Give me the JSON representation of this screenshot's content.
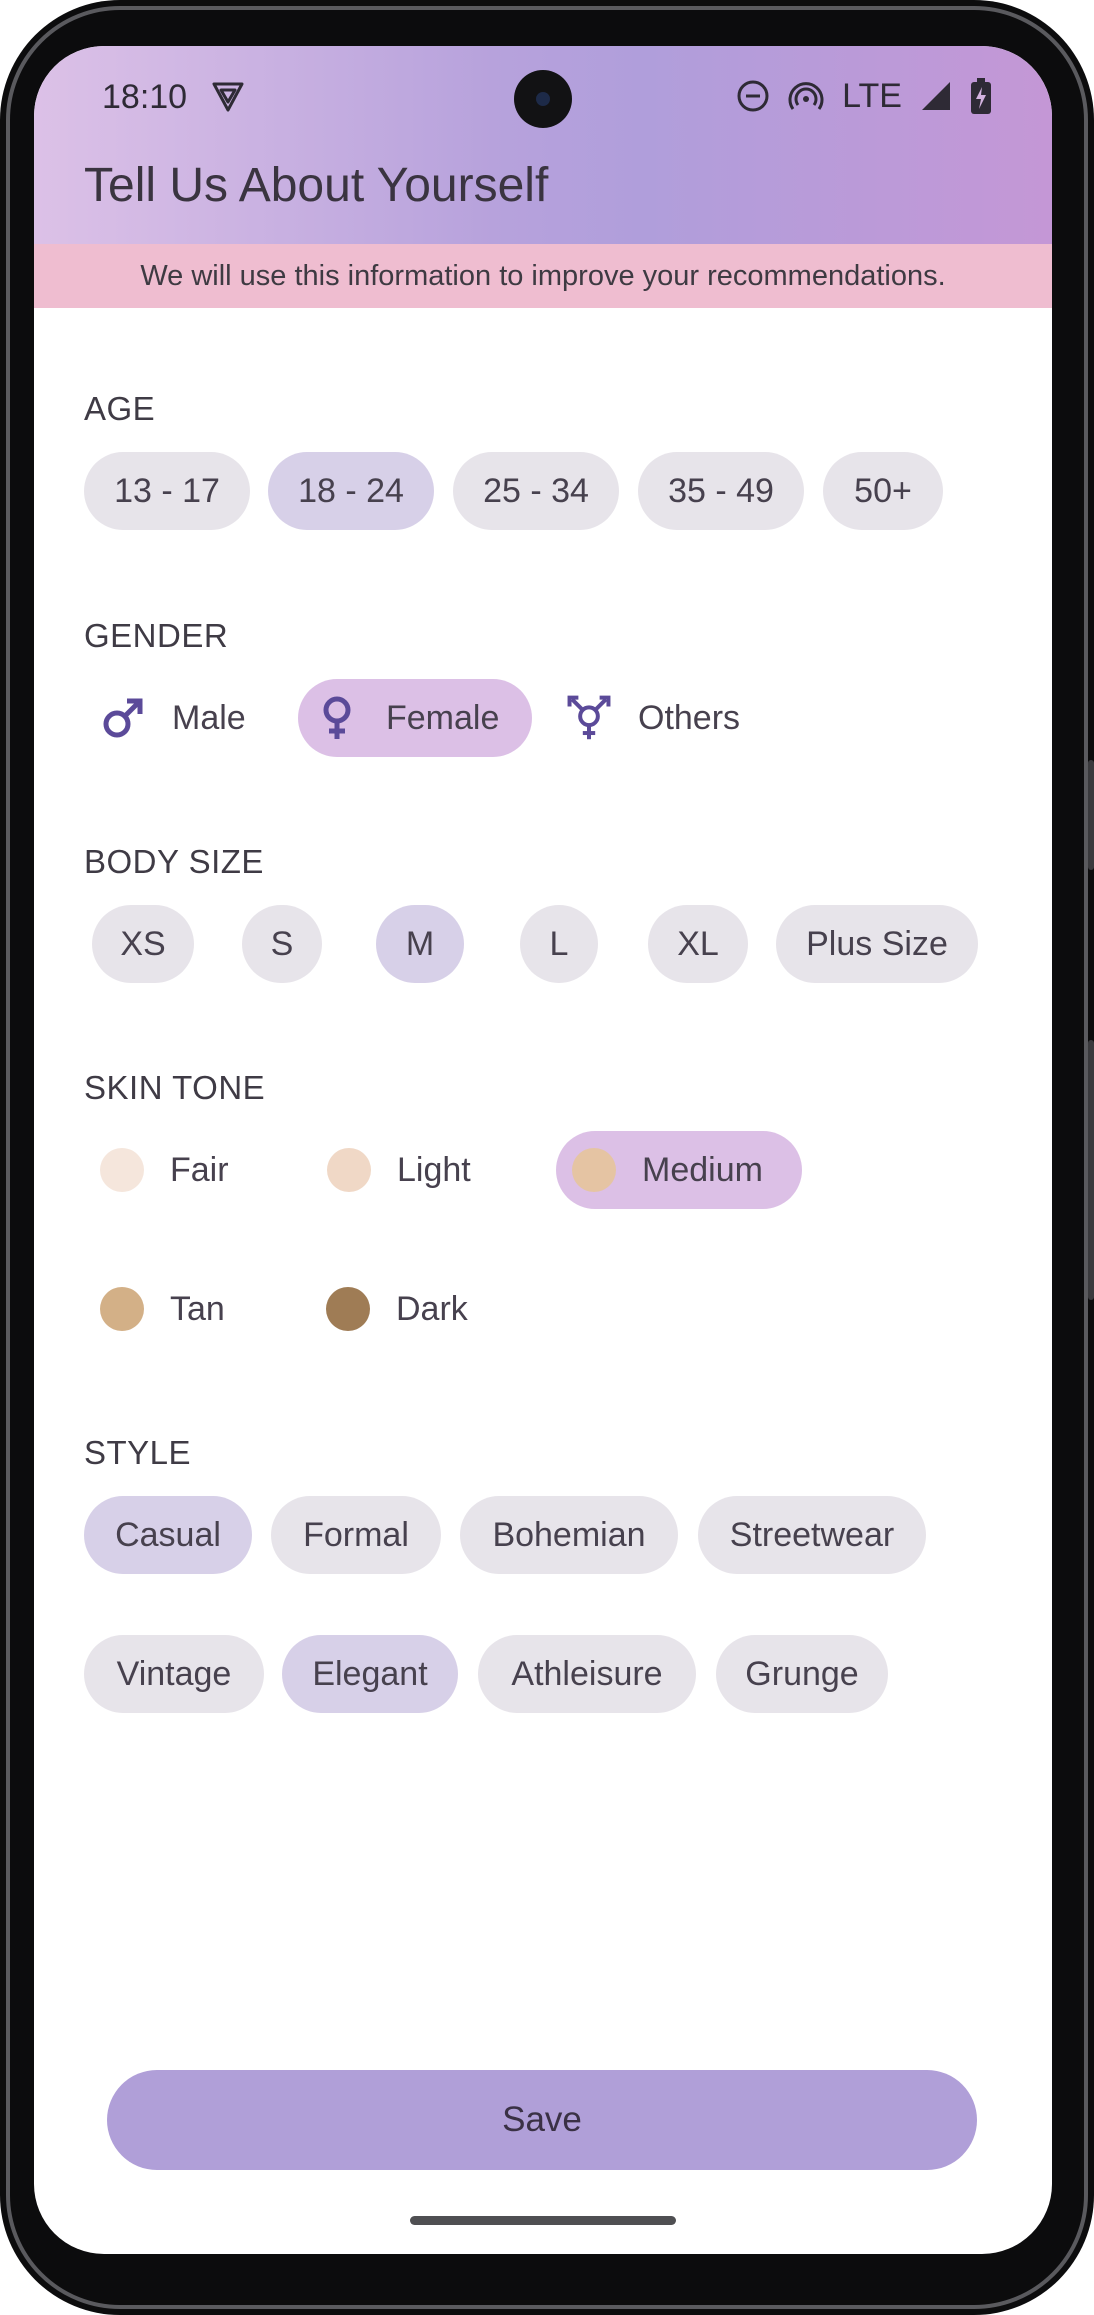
{
  "status_bar": {
    "time": "18:10",
    "network": "LTE"
  },
  "header": {
    "title": "Tell Us About Yourself"
  },
  "banner": {
    "text": "We will use this information to improve your recommendations."
  },
  "age": {
    "label": "AGE",
    "options": [
      "13 - 17",
      "18 - 24",
      "25 - 34",
      "35 - 49",
      "50+"
    ],
    "selected": "18 - 24"
  },
  "gender": {
    "label": "GENDER",
    "options": [
      {
        "label": "Male",
        "icon": "male-icon"
      },
      {
        "label": "Female",
        "icon": "female-icon"
      },
      {
        "label": "Others",
        "icon": "transgender-icon"
      }
    ],
    "selected": "Female"
  },
  "body_size": {
    "label": "BODY SIZE",
    "options": [
      "XS",
      "S",
      "M",
      "L",
      "XL",
      "Plus Size"
    ],
    "selected": "M"
  },
  "skin_tone": {
    "label": "SKIN TONE",
    "options": [
      {
        "label": "Fair",
        "color": "#f5e6dc"
      },
      {
        "label": "Light",
        "color": "#f0d8c6"
      },
      {
        "label": "Medium",
        "color": "#e5c4a3"
      },
      {
        "label": "Tan",
        "color": "#d3b087"
      },
      {
        "label": "Dark",
        "color": "#9f7c55"
      }
    ],
    "selected": "Medium"
  },
  "style": {
    "label": "STYLE",
    "options": [
      "Casual",
      "Formal",
      "Bohemian",
      "Streetwear",
      "Vintage",
      "Elegant",
      "Athleisure",
      "Grunge"
    ],
    "selected": [
      "Casual",
      "Elegant"
    ]
  },
  "save": {
    "label": "Save"
  },
  "colors": {
    "chip_bg": "#e7e4ea",
    "chip_selected_bg": "#d7d0e8",
    "option_selected_bg": "#dcc0e6",
    "banner_bg": "#efbdd0",
    "save_bg": "#b09fd8",
    "icon_color": "#5b4a99"
  }
}
